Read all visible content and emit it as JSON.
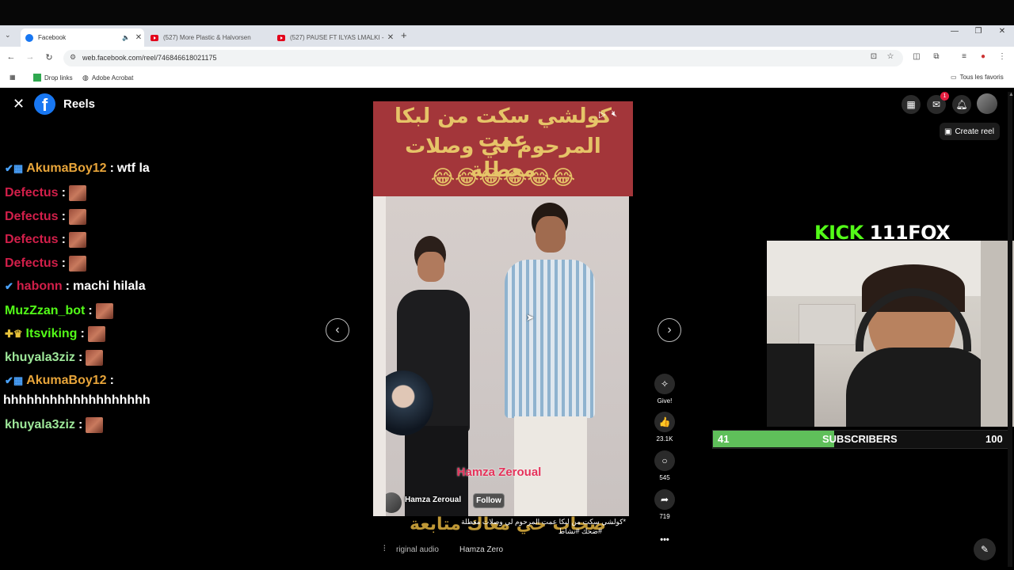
{
  "browser": {
    "tabs": [
      {
        "title": "Facebook",
        "active": true
      },
      {
        "title": "(527) More Plastic & Halvorsen",
        "active": false
      },
      {
        "title": "(527) PAUSE FT ILYAS LMALKI -",
        "active": false
      }
    ],
    "url": "web.facebook.com/reel/746846618021175",
    "bookmarks": [
      "Drop links",
      "Adobe Acrobat"
    ],
    "all_favorites": "Tous les favoris"
  },
  "fb": {
    "title": "Reels",
    "create_reel": "Create reel",
    "notification_count": "1"
  },
  "chat": [
    {
      "user": "AkumaBoy12",
      "message": "wtf la",
      "color": "#e8a53a",
      "badges": "✔▦",
      "emote": false
    },
    {
      "user": "Defectus",
      "message": "",
      "color": "#d21f4a",
      "badges": "",
      "emote": true
    },
    {
      "user": "Defectus",
      "message": "",
      "color": "#d21f4a",
      "badges": "",
      "emote": true
    },
    {
      "user": "Defectus",
      "message": "",
      "color": "#d21f4a",
      "badges": "",
      "emote": true
    },
    {
      "user": "Defectus",
      "message": "",
      "color": "#d21f4a",
      "badges": "",
      "emote": true
    },
    {
      "user": "habonn",
      "message": "machi hilala",
      "color": "#d21f4a",
      "badges": "✔",
      "emote": false
    },
    {
      "user": "MuzZzan_bot",
      "message": "",
      "color": "#53fc18",
      "badges": "",
      "emote": true
    },
    {
      "user": "Itsviking",
      "message": "",
      "color": "#53fc18",
      "badges": "✚♛",
      "emote": true
    },
    {
      "user": "khuyala3ziz",
      "message": "",
      "color": "#9ee89a",
      "badges": "",
      "emote": true
    },
    {
      "user": "AkumaBoy12",
      "message": "",
      "color": "#e8a53a",
      "badges": "✔▦",
      "emote": false
    },
    {
      "user": "",
      "message": "hhhhhhhhhhhhhhhhhhh",
      "color": "#fff",
      "badges": "",
      "emote": false
    },
    {
      "user": "khuyala3ziz",
      "message": "",
      "color": "#9ee89a",
      "badges": "",
      "emote": true
    }
  ],
  "video": {
    "caption_line1": "كولشي سكت من لبكا عمت",
    "caption_line2": "المرحوم لي وصلات معطلة",
    "emojis": "😂😂😂😂😂😂",
    "watermark": "Hamza Zeroual",
    "author": "Hamza Zeroual",
    "follow": "Follow",
    "description": "*كولشي سكت من لبكا عمت المرحوم لي وصلات معطلة",
    "description2": "#ضحك #نشاط",
    "audio": "riginal audio",
    "audio_author": "Hamza Zero",
    "bottom_overlay": "صحاب حي معاك متابعة"
  },
  "actions": [
    {
      "label": "Give!",
      "icon": "give-icon",
      "glyph": "✧"
    },
    {
      "label": "23.1K",
      "icon": "like-icon",
      "glyph": "👍"
    },
    {
      "label": "545",
      "icon": "comment-icon",
      "glyph": "○"
    },
    {
      "label": "719",
      "icon": "share-icon",
      "glyph": "➦"
    },
    {
      "label": "",
      "icon": "more-icon",
      "glyph": "•••"
    }
  ],
  "stream": {
    "brand": "KICK",
    "channel": "111FOX",
    "subs_current": "41",
    "subs_label": "SUBSCRIBERS",
    "subs_goal": "100",
    "subs_progress": 0.41
  },
  "colors": {
    "kick_green": "#53fc18",
    "band_red": "#a3363a",
    "caption_gold": "#e6c468",
    "fb_blue": "#1877f2"
  }
}
